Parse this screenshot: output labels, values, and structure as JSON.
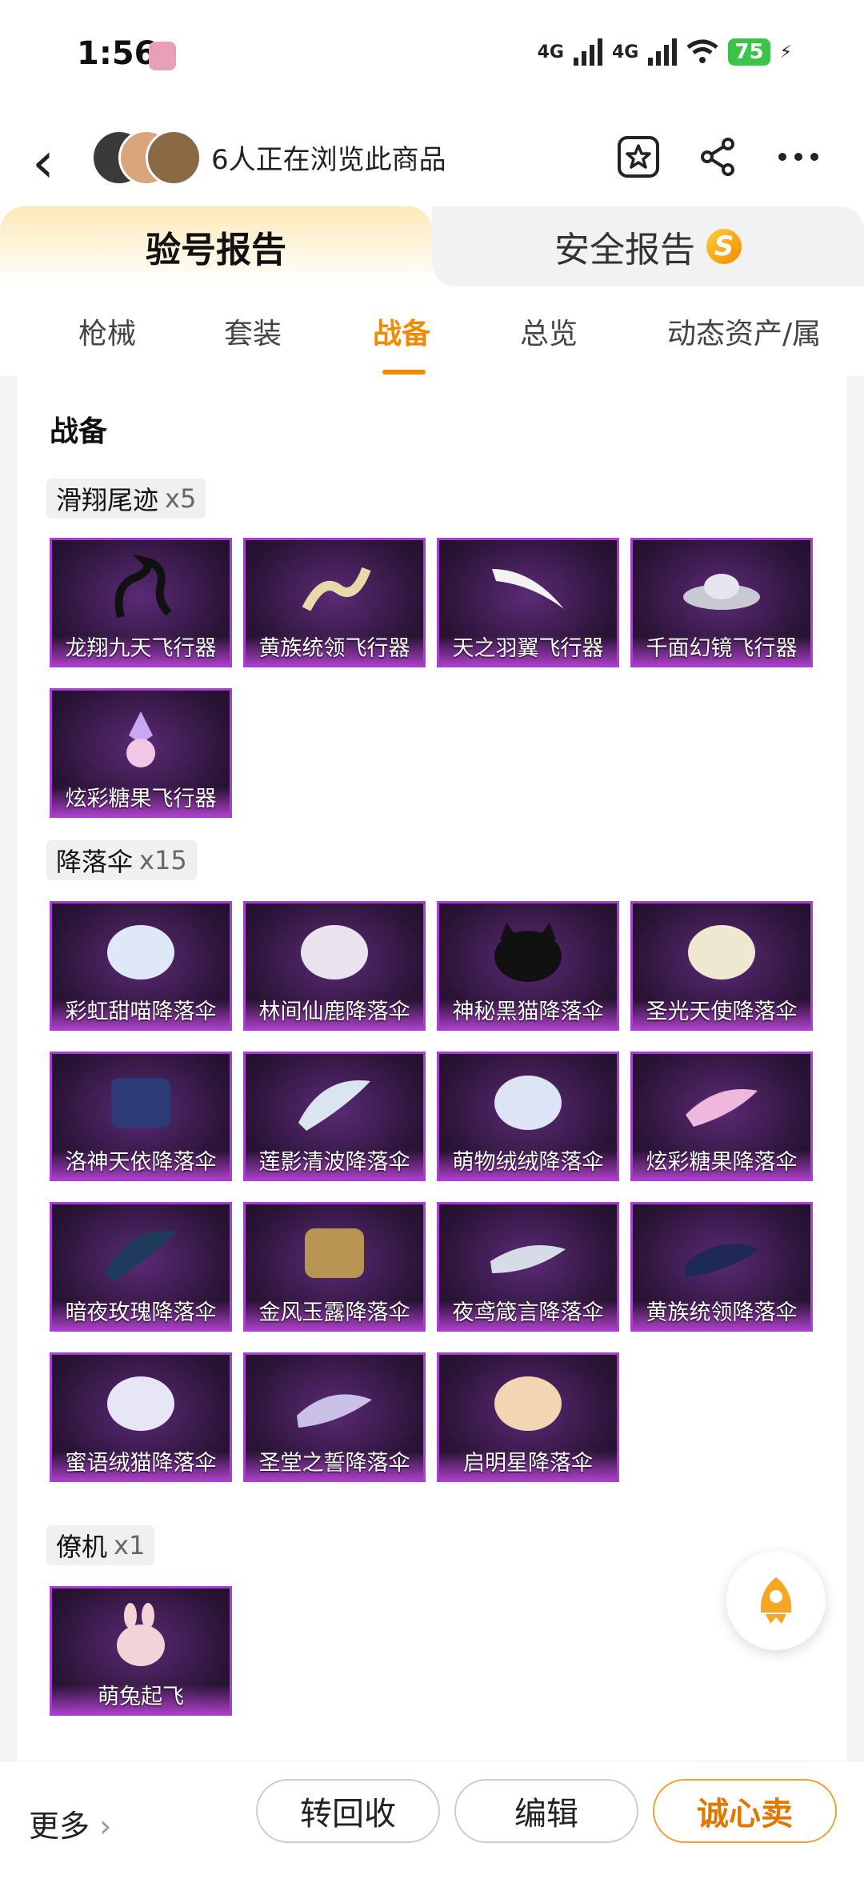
{
  "status": {
    "time": "1:56",
    "net1": "4G",
    "net2": "4G",
    "battery": "75"
  },
  "header": {
    "viewers": "6人正在浏览此商品"
  },
  "top_tabs": [
    {
      "label": "验号报告"
    },
    {
      "label": "安全报告"
    }
  ],
  "safe_badge": "S",
  "sub_tabs": [
    {
      "label": "枪械"
    },
    {
      "label": "套装"
    },
    {
      "label": "战备"
    },
    {
      "label": "总览"
    },
    {
      "label": "动态资产/属"
    }
  ],
  "section_title": "战备",
  "categories": [
    {
      "name": "滑翔尾迹",
      "count": "x5",
      "items": [
        "龙翔九天飞行器",
        "黄族统领飞行器",
        "天之羽翼飞行器",
        "千面幻镜飞行器",
        "炫彩糖果飞行器"
      ]
    },
    {
      "name": "降落伞",
      "count": "x15",
      "items": [
        "彩虹甜喵降落伞",
        "林间仙鹿降落伞",
        "神秘黑猫降落伞",
        "圣光天使降落伞",
        "洛神天依降落伞",
        "莲影清波降落伞",
        "萌物绒绒降落伞",
        "炫彩糖果降落伞",
        "暗夜玫瑰降落伞",
        "金风玉露降落伞",
        "夜鸢箴言降落伞",
        "黄族统领降落伞",
        "蜜语绒猫降落伞",
        "圣堂之誓降落伞",
        "启明星降落伞"
      ]
    },
    {
      "name": "僚机",
      "count": "x1",
      "items": [
        "萌兔起飞"
      ]
    }
  ],
  "bottom": {
    "more": "更多",
    "recycle": "转回收",
    "edit": "编辑",
    "sell": "诚心卖"
  },
  "colors": {
    "accent": "#f08a00",
    "card_border": "#a93ed0"
  }
}
